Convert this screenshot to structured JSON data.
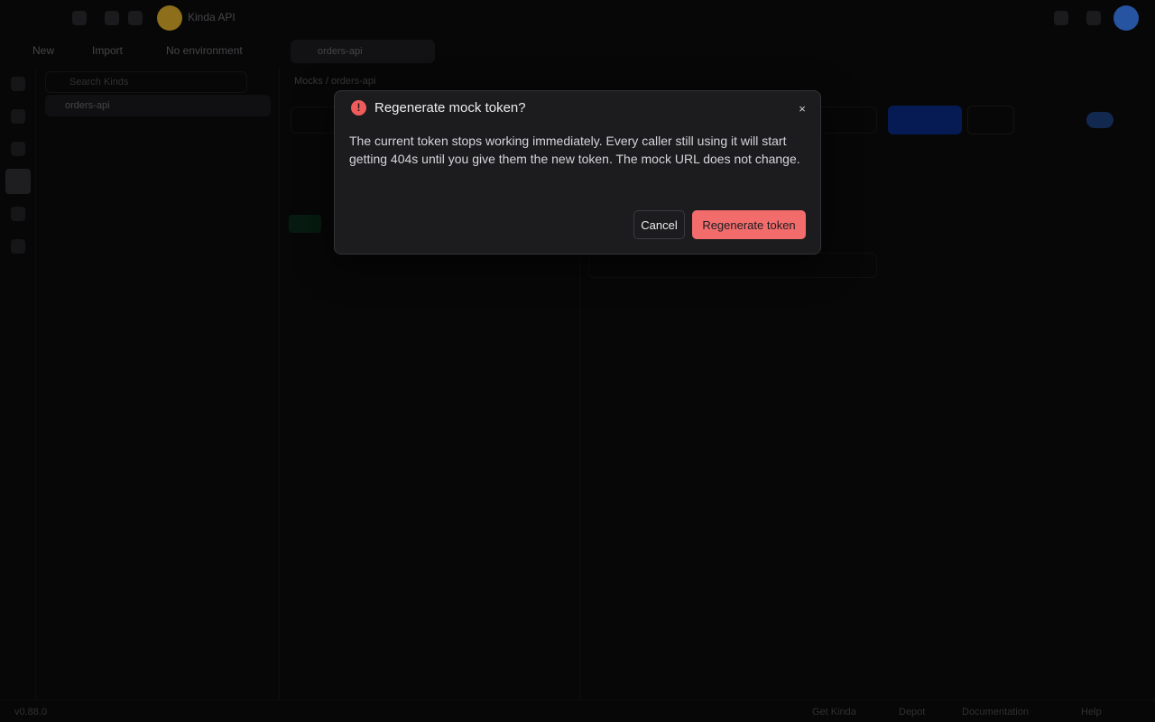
{
  "app": {
    "brand_name": "Kinda API",
    "toolbar": {
      "new_label": "New",
      "import_label": "Import",
      "environment_label": "No environment"
    },
    "sidebar": {
      "search_placeholder": "Search Kinds",
      "item_label": "orders-api"
    },
    "editor": {
      "tab_label": "orders-api",
      "breadcrumb": "Mocks  /  orders-api"
    },
    "statusbar": {
      "version": "v0.88.0",
      "get_kinda": "Get Kinda",
      "depot": "Depot",
      "documentation": "Documentation",
      "help": "Help"
    },
    "colors": {
      "accent": "#3b82f6",
      "danger": "#f26c6c",
      "dialog_bg": "#1c1c1f"
    }
  },
  "dialog": {
    "icon": "alert-circle-icon",
    "title": "Regenerate mock token?",
    "body": "The current token stops working immediately. Every caller still using it will start getting 404s until you give them the new token. The mock URL does not change.",
    "cancel_label": "Cancel",
    "confirm_label": "Regenerate token",
    "close_glyph": "×"
  }
}
